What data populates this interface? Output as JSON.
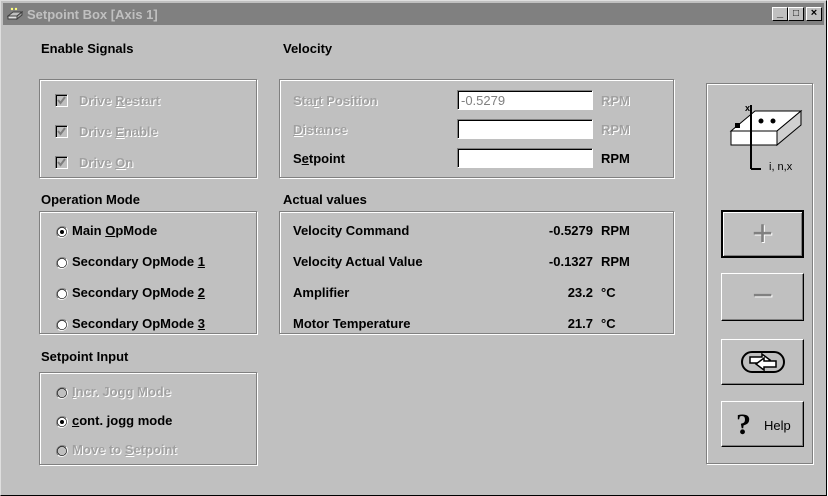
{
  "window": {
    "title": "Setpoint Box [Axis 1]",
    "controls": [
      "_",
      "□",
      "×"
    ]
  },
  "enable_signals": {
    "title": "Enable Signals",
    "items": [
      {
        "pre": "Drive ",
        "u": "R",
        "post": "estart",
        "checked": true,
        "enabled": false
      },
      {
        "pre": "Drive ",
        "u": "E",
        "post": "nable",
        "checked": true,
        "enabled": false
      },
      {
        "pre": "Drive ",
        "u": "O",
        "post": "n",
        "checked": true,
        "enabled": false
      }
    ]
  },
  "operation_mode": {
    "title": "Operation Mode",
    "items": [
      {
        "pre": "Main ",
        "u": "O",
        "post": "pMode",
        "selected": true
      },
      {
        "pre": "Secondary OpMode ",
        "u": "1",
        "post": "",
        "selected": false
      },
      {
        "pre": "Secondary OpMode ",
        "u": "2",
        "post": "",
        "selected": false
      },
      {
        "pre": "Secondary OpMode ",
        "u": "3",
        "post": "",
        "selected": false
      }
    ]
  },
  "setpoint_input": {
    "title": "Setpoint Input",
    "items": [
      {
        "pre": "",
        "u": "I",
        "post": "ncr. Jogg Mode",
        "selected": false,
        "enabled": false
      },
      {
        "pre": "",
        "u": "c",
        "post": "ont. jogg mode",
        "selected": true,
        "enabled": true
      },
      {
        "pre": "Move to ",
        "u": "S",
        "post": "etpoint",
        "selected": false,
        "enabled": false
      }
    ]
  },
  "velocity": {
    "title": "Velocity",
    "fields": [
      {
        "pre": "Sta",
        "u": "r",
        "post": "t Position",
        "value": "-0.5279",
        "unit": "RPM",
        "enabled": false
      },
      {
        "pre": "",
        "u": "D",
        "post": "istance",
        "value": "",
        "unit": "RPM",
        "enabled": false
      },
      {
        "pre": "S",
        "u": "e",
        "post": "tpoint",
        "value": "",
        "unit": "RPM",
        "enabled": true
      }
    ]
  },
  "actual_values": {
    "title": "Actual values",
    "rows": [
      {
        "label": "Velocity Command",
        "value": "-0.5279",
        "unit": "RPM"
      },
      {
        "label": "Velocity Actual Value",
        "value": "-0.1327",
        "unit": "RPM"
      },
      {
        "label": "Amplifier",
        "value": "23.2",
        "unit": "°C"
      },
      {
        "label": "Motor Temperature",
        "value": "21.7",
        "unit": "°C"
      }
    ]
  },
  "side_panel": {
    "axis_label": "i, n,x",
    "help_label": "Help",
    "plus": "+",
    "minus": "−"
  },
  "icons": [
    "app-icon",
    "minimize-icon",
    "maximize-icon",
    "close-icon",
    "axis-device-icon",
    "plus-icon",
    "minus-icon",
    "cycle-arrows-icon",
    "help-question-icon"
  ]
}
